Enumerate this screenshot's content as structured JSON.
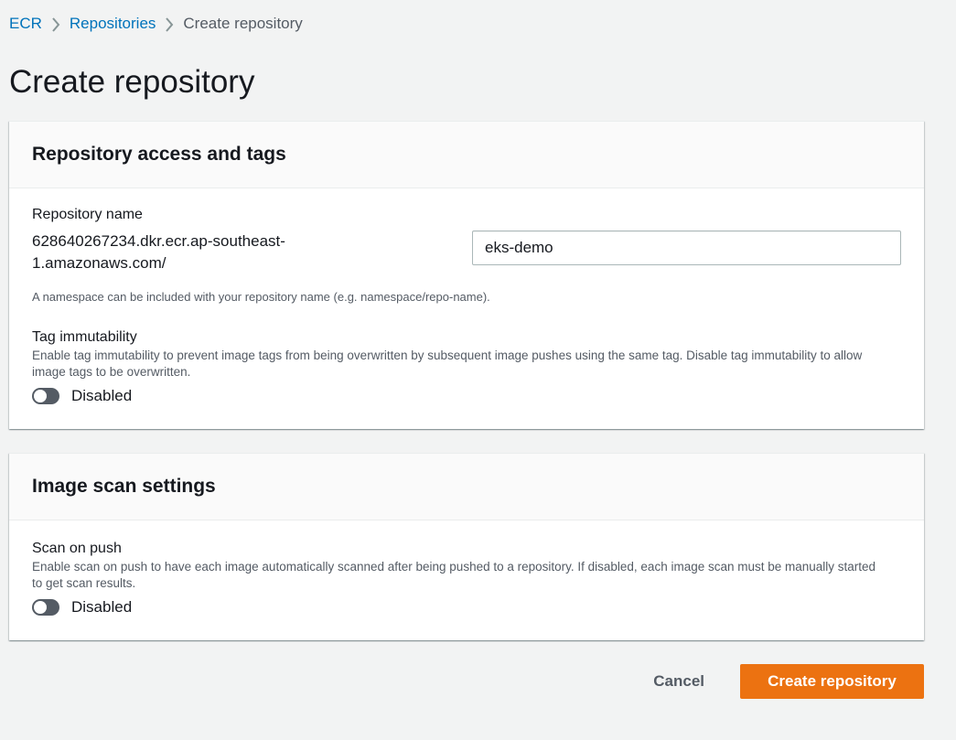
{
  "breadcrumb": {
    "items": [
      {
        "label": "ECR"
      },
      {
        "label": "Repositories"
      },
      {
        "label": "Create repository"
      }
    ]
  },
  "page": {
    "title": "Create repository"
  },
  "access_panel": {
    "title": "Repository access and tags",
    "repo_name_label": "Repository name",
    "repo_prefix": "628640267234.dkr.ecr.ap-southeast-1.amazonaws.com/",
    "repo_name_value": "eks-demo",
    "namespace_hint": "A namespace can be included with your repository name (e.g. namespace/repo-name).",
    "tag_immutability_label": "Tag immutability",
    "tag_immutability_description": "Enable tag immutability to prevent image tags from being overwritten by subsequent image pushes using the same tag. Disable tag immutability to allow image tags to be overwritten.",
    "tag_immutability_state": "Disabled"
  },
  "scan_panel": {
    "title": "Image scan settings",
    "scan_on_push_label": "Scan on push",
    "scan_on_push_description": "Enable scan on push to have each image automatically scanned after being pushed to a repository. If disabled, each image scan must be manually started to get scan results.",
    "scan_on_push_state": "Disabled"
  },
  "actions": {
    "cancel_label": "Cancel",
    "create_label": "Create repository"
  },
  "colors": {
    "accent": "#ec7211",
    "link": "#0073bb",
    "toggle_off": "#545b64"
  }
}
